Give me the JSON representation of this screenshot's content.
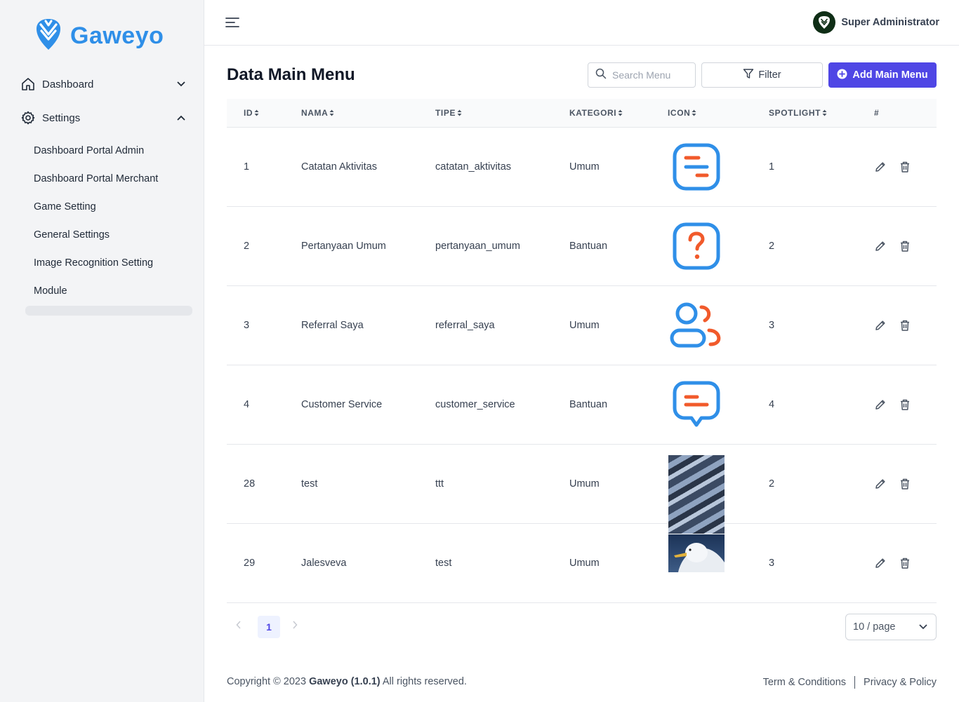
{
  "brand": {
    "name": "Gaweyo",
    "color": "#2f8fe8"
  },
  "sidebar": {
    "items": [
      {
        "label": "Dashboard",
        "icon": "home-icon",
        "expanded": false
      },
      {
        "label": "Settings",
        "icon": "gear-icon",
        "expanded": true
      }
    ],
    "settings_sub": [
      "Dashboard Portal Admin",
      "Dashboard Portal Merchant",
      "Game Setting",
      "General Settings",
      "Image Recognition Setting",
      "Module"
    ]
  },
  "topbar": {
    "user_name": "Super Administrator"
  },
  "main": {
    "title": "Data Main Menu",
    "search_placeholder": "Search Menu",
    "filter_label": "Filter",
    "add_label": "Add Main Menu",
    "accent": "#4f46e5"
  },
  "table": {
    "headers": {
      "id": "ID",
      "nama": "NAMA",
      "tipe": "TIPE",
      "kategori": "KATEGORI",
      "icon": "ICON",
      "spotlight": "SPOTLIGHT",
      "actions": "#"
    },
    "rows": [
      {
        "id": "1",
        "nama": "Catatan Aktivitas",
        "tipe": "catatan_aktivitas",
        "kategori": "Umum",
        "icon": "notes-icon",
        "spotlight": "1"
      },
      {
        "id": "2",
        "nama": "Pertanyaan Umum",
        "tipe": "pertanyaan_umum",
        "kategori": "Bantuan",
        "icon": "question-icon",
        "spotlight": "2"
      },
      {
        "id": "3",
        "nama": "Referral Saya",
        "tipe": "referral_saya",
        "kategori": "Umum",
        "icon": "referral-icon",
        "spotlight": "3"
      },
      {
        "id": "4",
        "nama": "Customer Service",
        "tipe": "customer_service",
        "kategori": "Bantuan",
        "icon": "chat-icon",
        "spotlight": "4"
      },
      {
        "id": "28",
        "nama": "test",
        "tipe": "ttt",
        "kategori": "Umum",
        "icon": "building-photo",
        "spotlight": "2"
      },
      {
        "id": "29",
        "nama": "Jalesveva",
        "tipe": "test",
        "kategori": "Umum",
        "icon": "seagull-photo",
        "spotlight": "3"
      }
    ]
  },
  "pagination": {
    "current_page": "1",
    "page_size": "10 / page"
  },
  "footer": {
    "copyright_prefix": "Copyright © 2023",
    "copyright_brand": "Gaweyo (1.0.1)",
    "copyright_suffix": "All rights reserved.",
    "terms": "Term & Conditions",
    "privacy": "Privacy & Policy"
  }
}
